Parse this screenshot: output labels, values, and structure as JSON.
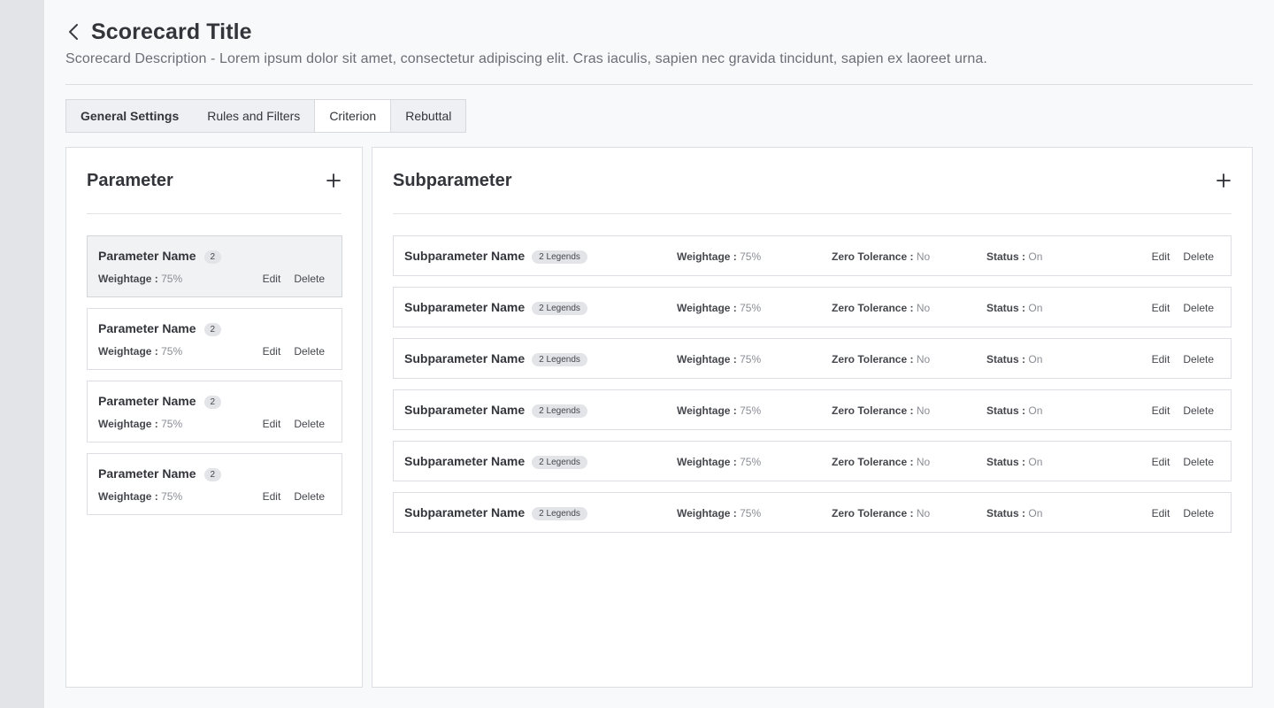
{
  "header": {
    "title": "Scorecard Title",
    "description": "Scorecard Description - Lorem ipsum dolor sit amet, consectetur adipiscing elit. Cras iaculis, sapien nec gravida tincidunt, sapien ex laoreet urna."
  },
  "tabs": [
    {
      "label": "General Settings",
      "active": false
    },
    {
      "label": "Rules and Filters",
      "active": false
    },
    {
      "label": "Criterion",
      "active": true
    },
    {
      "label": "Rebuttal",
      "active": false
    }
  ],
  "parameter_panel": {
    "title": "Parameter",
    "items": [
      {
        "name": "Parameter Name",
        "count": "2",
        "weightage_label": "Weightage :",
        "weightage_value": "75%",
        "edit": "Edit",
        "delete": "Delete",
        "selected": true
      },
      {
        "name": "Parameter Name",
        "count": "2",
        "weightage_label": "Weightage :",
        "weightage_value": "75%",
        "edit": "Edit",
        "delete": "Delete",
        "selected": false
      },
      {
        "name": "Parameter Name",
        "count": "2",
        "weightage_label": "Weightage :",
        "weightage_value": "75%",
        "edit": "Edit",
        "delete": "Delete",
        "selected": false
      },
      {
        "name": "Parameter Name",
        "count": "2",
        "weightage_label": "Weightage :",
        "weightage_value": "75%",
        "edit": "Edit",
        "delete": "Delete",
        "selected": false
      }
    ]
  },
  "subparameter_panel": {
    "title": "Subparameter",
    "items": [
      {
        "name": "Subparameter Name",
        "legends": "2 Legends",
        "weightage_label": "Weightage :",
        "weightage_value": "75%",
        "zero_label": "Zero Tolerance :",
        "zero_value": "No",
        "status_label": "Status :",
        "status_value": "On",
        "edit": "Edit",
        "delete": "Delete"
      },
      {
        "name": "Subparameter Name",
        "legends": "2 Legends",
        "weightage_label": "Weightage :",
        "weightage_value": "75%",
        "zero_label": "Zero Tolerance :",
        "zero_value": "No",
        "status_label": "Status :",
        "status_value": "On",
        "edit": "Edit",
        "delete": "Delete"
      },
      {
        "name": "Subparameter Name",
        "legends": "2 Legends",
        "weightage_label": "Weightage :",
        "weightage_value": "75%",
        "zero_label": "Zero Tolerance :",
        "zero_value": "No",
        "status_label": "Status :",
        "status_value": "On",
        "edit": "Edit",
        "delete": "Delete"
      },
      {
        "name": "Subparameter Name",
        "legends": "2 Legends",
        "weightage_label": "Weightage :",
        "weightage_value": "75%",
        "zero_label": "Zero Tolerance :",
        "zero_value": "No",
        "status_label": "Status :",
        "status_value": "On",
        "edit": "Edit",
        "delete": "Delete"
      },
      {
        "name": "Subparameter Name",
        "legends": "2 Legends",
        "weightage_label": "Weightage :",
        "weightage_value": "75%",
        "zero_label": "Zero Tolerance :",
        "zero_value": "No",
        "status_label": "Status :",
        "status_value": "On",
        "edit": "Edit",
        "delete": "Delete"
      },
      {
        "name": "Subparameter Name",
        "legends": "2 Legends",
        "weightage_label": "Weightage :",
        "weightage_value": "75%",
        "zero_label": "Zero Tolerance :",
        "zero_value": "No",
        "status_label": "Status :",
        "status_value": "On",
        "edit": "Edit",
        "delete": "Delete"
      }
    ]
  },
  "icons": {
    "back": "chevron-left-icon",
    "add_parameter": "plus-icon",
    "add_subparameter": "plus-icon"
  }
}
